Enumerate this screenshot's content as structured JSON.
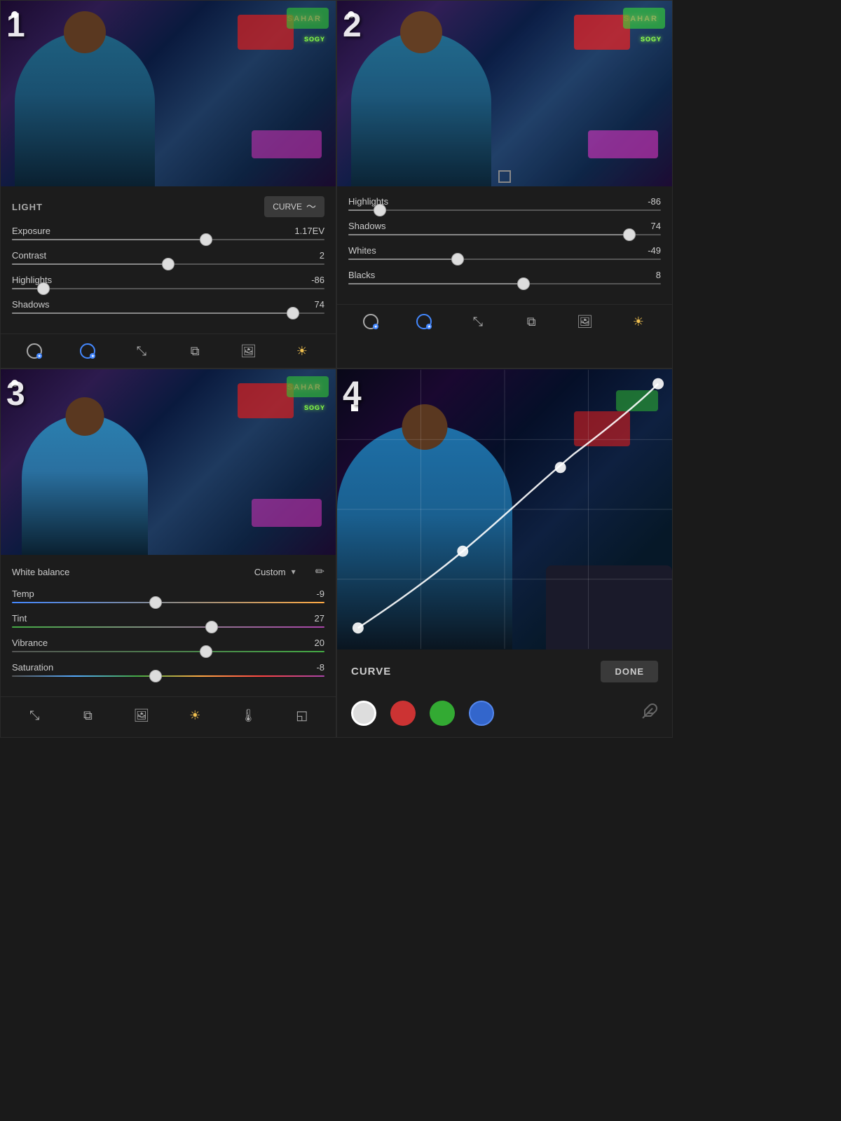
{
  "panels": {
    "p1": {
      "number": "1",
      "section": "LIGHT",
      "curve_btn": "CURVE",
      "sliders": [
        {
          "label": "Exposure",
          "value": "1.17EV",
          "percent": 62
        },
        {
          "label": "Contrast",
          "value": "2",
          "percent": 50
        },
        {
          "label": "Highlights",
          "value": "-86",
          "percent": 10
        },
        {
          "label": "Shadows",
          "value": "74",
          "percent": 90
        }
      ]
    },
    "p2": {
      "number": "2",
      "sliders": [
        {
          "label": "Highlights",
          "value": "-86",
          "percent": 10
        },
        {
          "label": "Shadows",
          "value": "74",
          "percent": 90
        },
        {
          "label": "Whites",
          "value": "-49",
          "percent": 35
        },
        {
          "label": "Blacks",
          "value": "8",
          "percent": 56
        }
      ]
    },
    "p3": {
      "number": "3",
      "white_balance_label": "White balance",
      "white_balance_value": "Custom",
      "sliders": [
        {
          "label": "Temp",
          "value": "-9",
          "percent": 46,
          "type": "temp"
        },
        {
          "label": "Tint",
          "value": "27",
          "percent": 64,
          "type": "tint"
        },
        {
          "label": "Vibrance",
          "value": "20",
          "percent": 62,
          "type": "vibrance"
        },
        {
          "label": "Saturation",
          "value": "-8",
          "percent": 46,
          "type": "saturation"
        }
      ]
    },
    "p4": {
      "number": "4",
      "curve_label": "CURVE",
      "done_label": "DONE",
      "channels": [
        {
          "color": "white",
          "active": true
        },
        {
          "color": "red",
          "active": false
        },
        {
          "color": "green",
          "active": false
        },
        {
          "color": "blue",
          "active": false
        }
      ]
    }
  },
  "toolbar": {
    "items": [
      "⊙",
      "✏",
      "⤡",
      "⧉",
      "🖼",
      "☀"
    ]
  },
  "bottom_nav": {
    "items": [
      "⤡",
      "⧉",
      "🖼",
      "☀",
      "🌡",
      "◱"
    ]
  }
}
